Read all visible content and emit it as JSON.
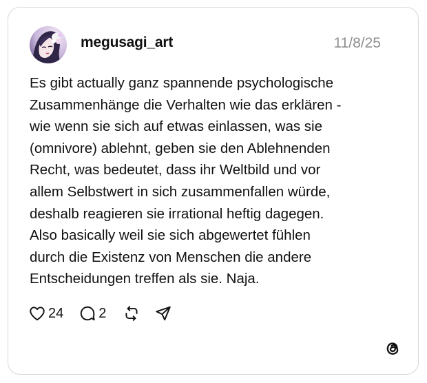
{
  "post": {
    "username": "megusagi_art",
    "date": "11/8/25",
    "lines": [
      "Es gibt actually ganz spannende psychologische",
      "Zusammenhänge die Verhalten wie das erklären -",
      "wie wenn sie sich auf etwas einlassen, was sie",
      "(omnivore) ablehnt, geben sie den Ablehnenden",
      "Recht, was bedeutet, dass ihr Weltbild und vor",
      "allem Selbstwert in sich zusammenfallen würde,",
      "deshalb reagieren sie irrational heftig dagegen.",
      "Also basically weil sie sich abgewertet fühlen",
      "durch die Existenz von Menschen die andere",
      "Entscheidungen treffen als sie. Naja."
    ],
    "likes": "24",
    "replies": "2"
  },
  "icons": {
    "like": "heart-icon",
    "reply": "comment-icon",
    "repost": "repost-icon",
    "share": "send-icon",
    "brand": "threads-logo-icon"
  },
  "colors": {
    "text": "#111111",
    "muted": "#8e8e8e",
    "border": "#d9d9d9"
  }
}
